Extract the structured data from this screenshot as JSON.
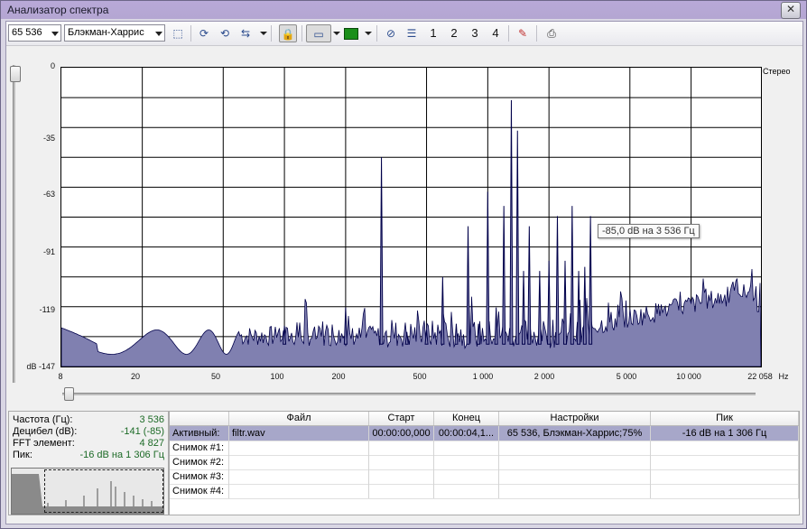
{
  "window": {
    "title": "Анализатор спектра"
  },
  "toolbar": {
    "fft_size": "65 536",
    "window_type": "Блэкман-Харрис",
    "snapshots": [
      "1",
      "2",
      "3",
      "4"
    ]
  },
  "chart_data": {
    "type": "area",
    "x_scale": "log",
    "xlim": [
      8,
      22058
    ],
    "ylim": [
      -147,
      0
    ],
    "y_ticks": [
      "0",
      "-35",
      "-63",
      "-91",
      "-119",
      "dB -147"
    ],
    "x_ticks": [
      "8",
      "20",
      "50",
      "100",
      "200",
      "500",
      "1 000",
      "2 000",
      "5 000",
      "10 000",
      "22 058"
    ],
    "x_unit": "Hz",
    "channel_label": "Стерео",
    "tooltip": "-85,0 dB на 3 536 Гц",
    "fill_color": "#8080b0",
    "line_color": "#00004a",
    "peaks": [
      {
        "f": 100,
        "db": -127
      },
      {
        "f": 200,
        "db": -118
      },
      {
        "f": 300,
        "db": -44
      },
      {
        "f": 400,
        "db": -130
      },
      {
        "f": 500,
        "db": -129
      },
      {
        "f": 600,
        "db": -103
      },
      {
        "f": 700,
        "db": -126
      },
      {
        "f": 800,
        "db": -78
      },
      {
        "f": 900,
        "db": -126
      },
      {
        "f": 1000,
        "db": -61
      },
      {
        "f": 1100,
        "db": -118
      },
      {
        "f": 1200,
        "db": -68
      },
      {
        "f": 1306,
        "db": -16
      },
      {
        "f": 1400,
        "db": -31
      },
      {
        "f": 1500,
        "db": -100
      },
      {
        "f": 1600,
        "db": -78
      },
      {
        "f": 1800,
        "db": -100
      },
      {
        "f": 2000,
        "db": -95
      },
      {
        "f": 2200,
        "db": -73
      },
      {
        "f": 2400,
        "db": -95
      },
      {
        "f": 2600,
        "db": -68
      },
      {
        "f": 2800,
        "db": -100
      },
      {
        "f": 3000,
        "db": -98
      },
      {
        "f": 3200,
        "db": -73
      }
    ]
  },
  "info": {
    "freq_label": "Частота (Гц):",
    "freq_value": "3 536",
    "db_label": "Децибел (dB):",
    "db_value": "-141 (-85)",
    "fft_label": "FFT элемент:",
    "fft_value": "4 827",
    "peak_label": "Пик:",
    "peak_value": "-16 dB на 1 306 Гц"
  },
  "table": {
    "headers": [
      "",
      "Файл",
      "Старт",
      "Конец",
      "Настройки",
      "Пик"
    ],
    "rows": [
      {
        "label": "Активный:",
        "file": "filtr.wav",
        "start": "00:00:00,000",
        "end": "00:00:04,1...",
        "settings": "65 536, Блэкман-Харрис;75%",
        "peak": "-16 dB на 1 306 Гц"
      },
      {
        "label": "Снимок #1:",
        "file": "",
        "start": "",
        "end": "",
        "settings": "",
        "peak": ""
      },
      {
        "label": "Снимок #2:",
        "file": "",
        "start": "",
        "end": "",
        "settings": "",
        "peak": ""
      },
      {
        "label": "Снимок #3:",
        "file": "",
        "start": "",
        "end": "",
        "settings": "",
        "peak": ""
      },
      {
        "label": "Снимок #4:",
        "file": "",
        "start": "",
        "end": "",
        "settings": "",
        "peak": ""
      }
    ]
  }
}
